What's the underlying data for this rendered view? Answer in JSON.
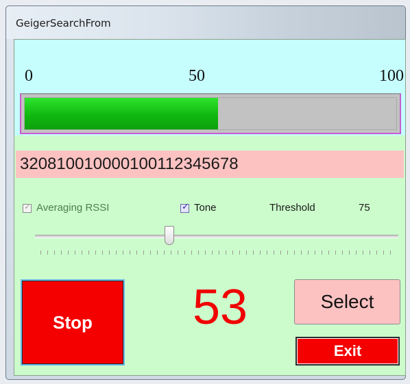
{
  "window": {
    "title": "GeigerSearchFrom"
  },
  "meter": {
    "scale": {
      "min": "0",
      "mid": "50",
      "max": "100"
    },
    "level_percent": 52,
    "fill_color": "#10b810"
  },
  "tag_id": "32081001000010011234567­8",
  "options": {
    "averaging_rssi": {
      "label": "Averaging RSSI",
      "checked": true,
      "enabled": false
    },
    "tone": {
      "label": "Tone",
      "checked": true,
      "enabled": true
    },
    "threshold_label": "Threshold",
    "threshold_value": "75"
  },
  "slider": {
    "value_fraction": 0.37
  },
  "readout": {
    "value": "53",
    "color": "#f00000"
  },
  "buttons": {
    "stop": "Stop",
    "select": "Select",
    "exit": "Exit"
  },
  "colors": {
    "background": "#ccfccc",
    "meter_panel": "#c6fdfd",
    "id_panel": "#fcc2c2",
    "danger": "#f40000"
  }
}
